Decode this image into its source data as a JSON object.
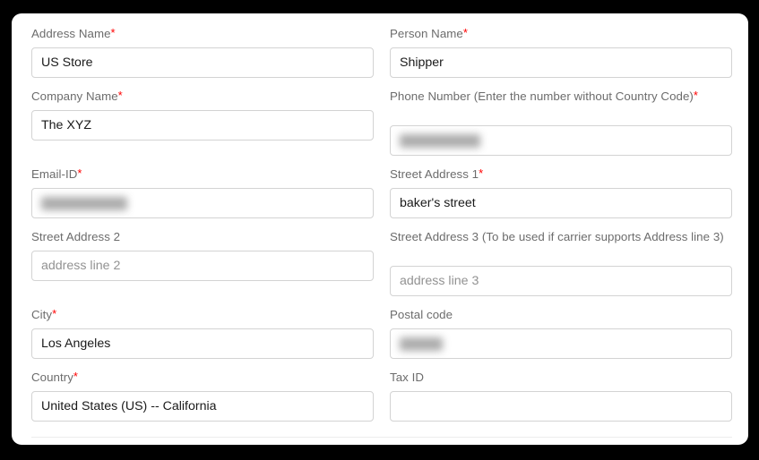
{
  "form": {
    "fields": [
      {
        "key": "address_name",
        "label": "Address Name",
        "required": true,
        "value": "US Store",
        "placeholder": "",
        "state": "filled",
        "column": "left"
      },
      {
        "key": "person_name",
        "label": "Person Name",
        "required": true,
        "value": "Shipper",
        "placeholder": "",
        "state": "filled",
        "column": "right"
      },
      {
        "key": "company_name",
        "label": "Company Name",
        "required": true,
        "value": "The XYZ",
        "placeholder": "",
        "state": "filled",
        "column": "left"
      },
      {
        "key": "phone_number",
        "label": "Phone Number (Enter the number without Country Code)",
        "required": true,
        "value": "",
        "placeholder": "",
        "state": "redacted",
        "column": "right"
      },
      {
        "key": "email_id",
        "label": "Email-ID",
        "required": true,
        "value": "",
        "placeholder": "",
        "state": "redacted",
        "column": "left"
      },
      {
        "key": "street_address_1",
        "label": "Street Address 1",
        "required": true,
        "value": "baker's street",
        "placeholder": "",
        "state": "filled",
        "column": "right"
      },
      {
        "key": "street_address_2",
        "label": "Street Address 2",
        "required": false,
        "value": "",
        "placeholder": "address line 2",
        "state": "placeholder",
        "column": "left"
      },
      {
        "key": "street_address_3",
        "label": "Street Address 3 (To be used if carrier supports Address line 3)",
        "required": false,
        "value": "",
        "placeholder": "address line 3",
        "state": "placeholder",
        "column": "right"
      },
      {
        "key": "city",
        "label": "City",
        "required": true,
        "value": "Los Angeles",
        "placeholder": "",
        "state": "filled",
        "column": "left"
      },
      {
        "key": "postal_code",
        "label": "Postal code",
        "required": false,
        "value": "",
        "placeholder": "",
        "state": "redacted",
        "column": "right"
      },
      {
        "key": "country",
        "label": "Country",
        "required": true,
        "value": "United States (US) -- California",
        "placeholder": "",
        "state": "filled",
        "column": "left"
      },
      {
        "key": "tax_id",
        "label": "Tax ID",
        "required": false,
        "value": "",
        "placeholder": "",
        "state": "empty",
        "column": "right"
      }
    ],
    "required_marker": "*",
    "colors": {
      "label": "#6c6c6c",
      "required_marker": "#ff0000",
      "input_border": "#d3d3d3",
      "input_text": "#1a1a1a",
      "placeholder_text": "#929292",
      "card_background": "#ffffff",
      "page_background": "#000000"
    }
  }
}
